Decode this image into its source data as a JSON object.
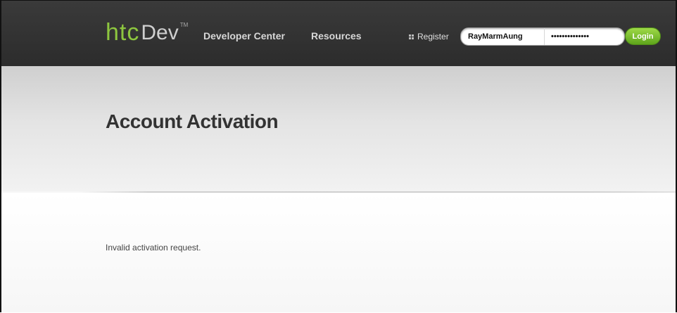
{
  "header": {
    "logo": {
      "htc": "htc",
      "dev": "Dev",
      "tm": "TM"
    },
    "nav": [
      {
        "label": "Developer Center"
      },
      {
        "label": "Resources"
      }
    ],
    "register_label": "Register",
    "login": {
      "username_value": "RayMarmAung",
      "password_value": "••••••••••••••",
      "button_label": "Login"
    },
    "colors": {
      "bar": "#333333",
      "logo_green": "#8dc63f",
      "login_button": "#7ac231"
    }
  },
  "main": {
    "title": "Account Activation",
    "message": "Invalid activation request."
  }
}
